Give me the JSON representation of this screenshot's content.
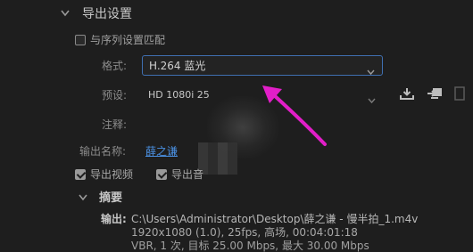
{
  "export_settings": {
    "title": "导出设置",
    "match_sequence_label": "与序列设置匹配",
    "match_sequence_checked": false,
    "format": {
      "label": "格式:",
      "value": "H.264 蓝光"
    },
    "preset": {
      "label": "预设:",
      "value": "HD 1080i 25"
    },
    "comments": {
      "label": "注释:"
    },
    "output_name": {
      "label": "输出名称:",
      "value": "薛之谦"
    },
    "export_video": {
      "label": "导出视频",
      "checked": true
    },
    "export_audio": {
      "label": "导出音",
      "checked": true
    }
  },
  "summary": {
    "title": "摘要",
    "output_label": "输出:",
    "output_path": "C:\\Users\\Administrator\\Desktop\\薛之谦 - 慢半拍_1.m4v",
    "output_details": "1920x1080 (1.0), 25fps, 高场, 00:04:01:18",
    "output_more": "VBR, 1 次, 目标 25.00 Mbps, 最大 30.00 Mbps"
  },
  "icons": {
    "section_toggle": "chevron-down-icon",
    "summary_toggle": "chevron-down-icon",
    "dropdown": "chevron-down-icon",
    "save_preset": "download-icon",
    "import_preset": "import-icon",
    "delete_preset": "trash-icon"
  },
  "colors": {
    "background": "#1e1e1e",
    "link": "#4a8fe0",
    "focus_border": "#3f6fb0",
    "annotation_arrow": "#e21ec8"
  }
}
